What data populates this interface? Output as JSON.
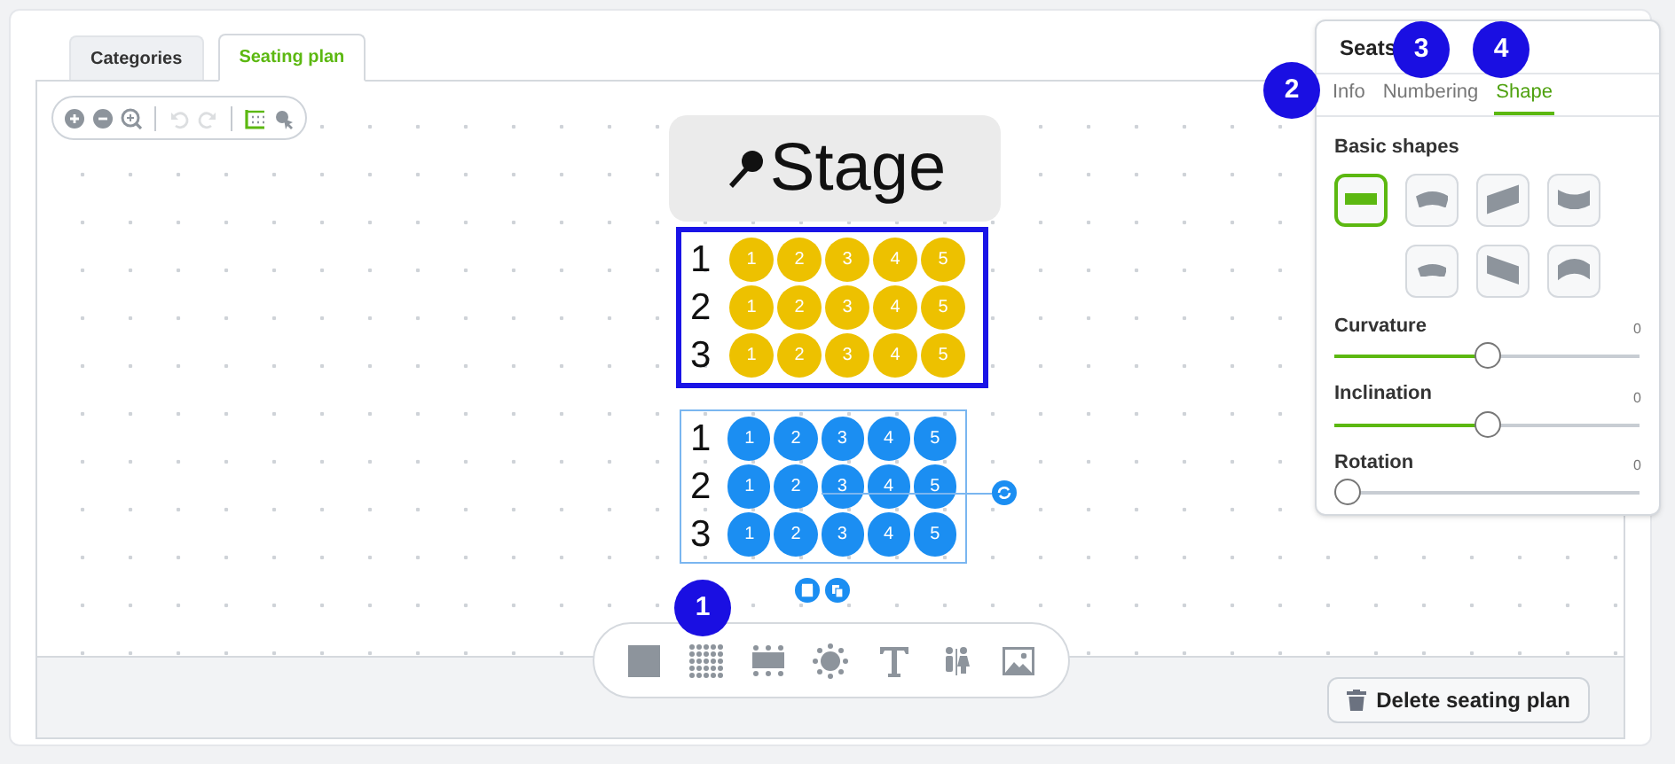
{
  "tabs": [
    {
      "label": "Categories",
      "selected": false
    },
    {
      "label": "Seating plan",
      "selected": true
    }
  ],
  "view_toolbar": [
    {
      "kind": "zoom-in",
      "disabled": false
    },
    {
      "kind": "zoom-out",
      "disabled": false
    },
    {
      "kind": "zoom-fit",
      "disabled": false
    },
    {
      "kind": "undo",
      "disabled": true
    },
    {
      "kind": "redo",
      "disabled": true
    },
    {
      "kind": "grid",
      "disabled": false
    },
    {
      "kind": "pin",
      "disabled": false
    }
  ],
  "stage": {
    "label": "Stage"
  },
  "seat_blocks": [
    {
      "color": "#edc100",
      "selected": false,
      "highlighted": true,
      "rows": [
        {
          "label": "1",
          "seats": [
            "1",
            "2",
            "3",
            "4",
            "5"
          ]
        },
        {
          "label": "2",
          "seats": [
            "1",
            "2",
            "3",
            "4",
            "5"
          ]
        },
        {
          "label": "3",
          "seats": [
            "1",
            "2",
            "3",
            "4",
            "5"
          ]
        }
      ]
    },
    {
      "color": "#1b8ef2",
      "selected": true,
      "highlighted": false,
      "rows": [
        {
          "label": "1",
          "seats": [
            "1",
            "2",
            "3",
            "4",
            "5"
          ]
        },
        {
          "label": "2",
          "seats": [
            "1",
            "2",
            "3",
            "4",
            "5"
          ]
        },
        {
          "label": "3",
          "seats": [
            "1",
            "2",
            "3",
            "4",
            "5"
          ]
        }
      ]
    }
  ],
  "add_toolbar": [
    {
      "kind": "square"
    },
    {
      "kind": "seat-grid"
    },
    {
      "kind": "table"
    },
    {
      "kind": "round-table"
    },
    {
      "kind": "text"
    },
    {
      "kind": "restroom"
    },
    {
      "kind": "image"
    }
  ],
  "delete_button": "Delete seating plan",
  "panel": {
    "title": "Seats",
    "tabs": [
      {
        "label": "Info",
        "selected": false
      },
      {
        "label": "Numbering",
        "selected": false
      },
      {
        "label": "Shape",
        "selected": true
      }
    ],
    "section": "Basic shapes",
    "shapes": [
      {
        "kind": "rect",
        "selected": true
      },
      {
        "kind": "arc-down",
        "selected": false
      },
      {
        "kind": "slant-up",
        "selected": false
      },
      {
        "kind": "concave",
        "selected": false
      },
      {
        "kind": "arc",
        "selected": false
      },
      {
        "kind": "slant-down",
        "selected": false
      },
      {
        "kind": "arch",
        "selected": false
      }
    ],
    "sliders": [
      {
        "label": "Curvature",
        "reading": "0",
        "level": 0.5
      },
      {
        "label": "Inclination",
        "reading": "0",
        "level": 0.5
      },
      {
        "label": "Rotation",
        "reading": "0",
        "level": 0
      }
    ]
  },
  "callouts": [
    "1",
    "2",
    "3",
    "4"
  ]
}
